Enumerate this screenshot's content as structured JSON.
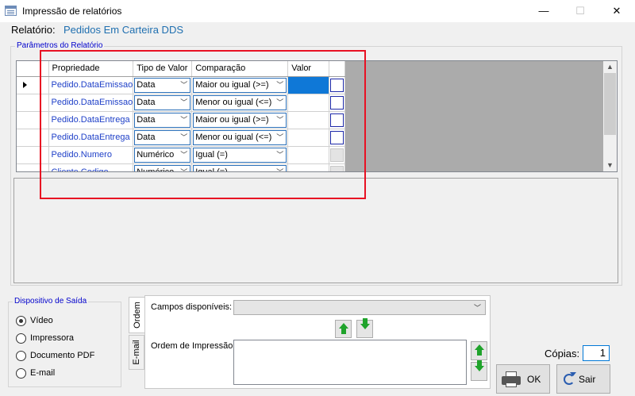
{
  "window": {
    "title": "Impressão de relatórios",
    "controls": {
      "minimize": "—",
      "maximize": "☐",
      "close": "✕"
    }
  },
  "report": {
    "label": "Relatório:",
    "name": "Pedidos Em Carteira DDS"
  },
  "params": {
    "group_title": "Parâmetros do Relatório",
    "columns": [
      "Propriedade",
      "Tipo de Valor",
      "Comparação",
      "Valor"
    ],
    "rows": [
      {
        "propriedade": "Pedido.DataEmissao",
        "tipo": "Data",
        "comparacao": "Maior ou igual (>=)",
        "valor": ""
      },
      {
        "propriedade": "Pedido.DataEmissao",
        "tipo": "Data",
        "comparacao": "Menor ou igual (<=)",
        "valor": ""
      },
      {
        "propriedade": "Pedido.DataEntrega",
        "tipo": "Data",
        "comparacao": "Maior ou igual (>=)",
        "valor": ""
      },
      {
        "propriedade": "Pedido.DataEntrega",
        "tipo": "Data",
        "comparacao": "Menor ou igual (<=)",
        "valor": ""
      },
      {
        "propriedade": "Pedido.Numero",
        "tipo": "Numérico",
        "comparacao": "Igual (=)",
        "valor": ""
      },
      {
        "propriedade": "Cliente.Codigo",
        "tipo": "Numérico",
        "comparacao": "Igual (=)",
        "valor": ""
      }
    ]
  },
  "output": {
    "group_title": "Dispositivo de Saída",
    "options": [
      "Vídeo",
      "Impressora",
      "Documento PDF",
      "E-mail"
    ],
    "selected": "Vídeo"
  },
  "tabs": {
    "items": [
      "Ordem",
      "E-mail"
    ],
    "campos_label": "Campos disponíveis:",
    "ordem_label": "Ordem de Impressão:"
  },
  "copies": {
    "label": "Cópias:",
    "value": "1"
  },
  "buttons": {
    "ok": "OK",
    "sair": "Sair"
  },
  "colors": {
    "accent": "#0078d7",
    "highlight_box": "#e81123",
    "link_blue": "#1f6fb0"
  }
}
